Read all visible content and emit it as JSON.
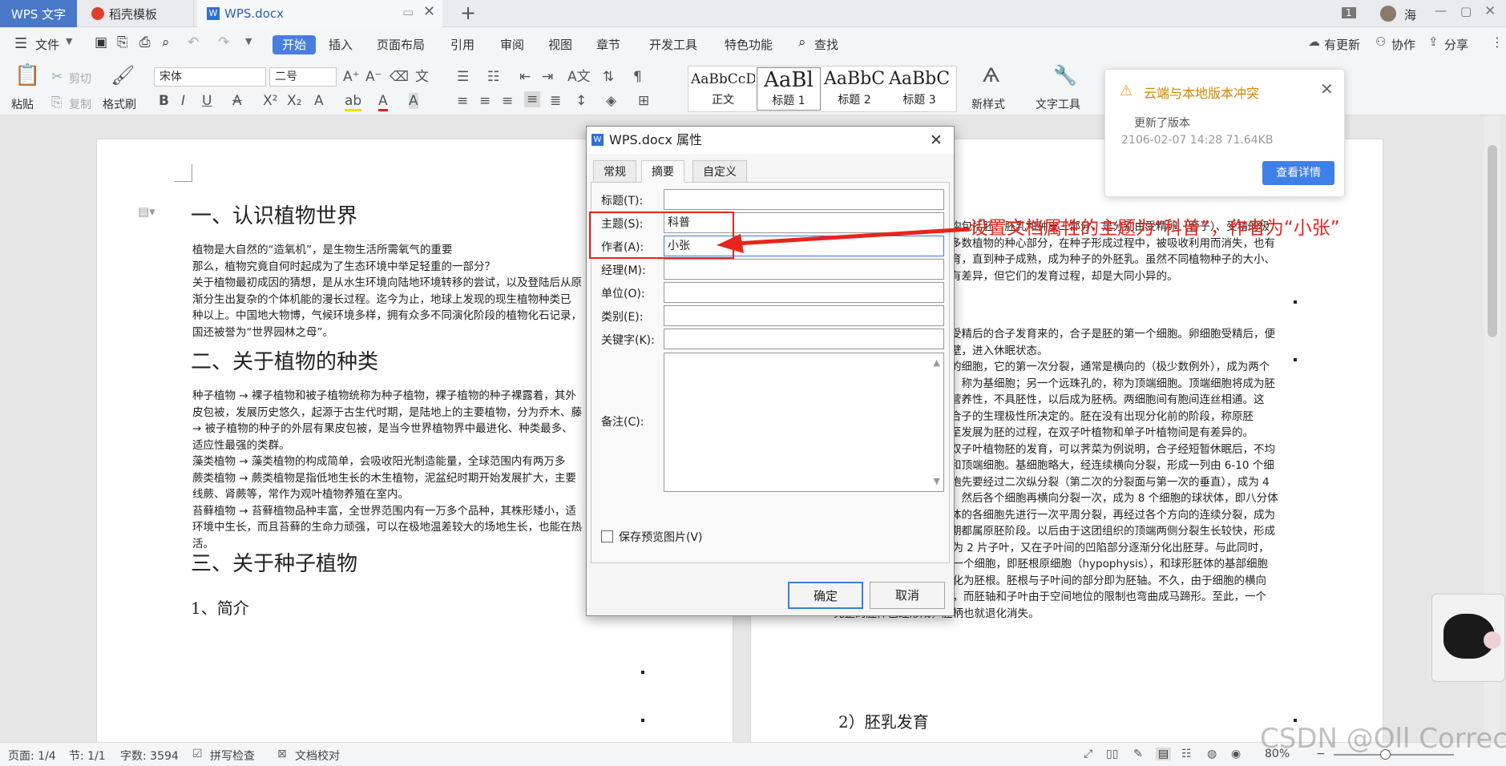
{
  "tabs": {
    "app": "WPS 文字",
    "template": "稻壳模板",
    "doc": "WPS.docx"
  },
  "tabbar_right": {
    "badge": "1",
    "user": "海"
  },
  "menu": {
    "file": "文件",
    "start": "开始",
    "insert": "插入",
    "layout": "页面布局",
    "ref": "引用",
    "review": "审阅",
    "view": "视图",
    "chapter": "章节",
    "dev": "开发工具",
    "special": "特色功能",
    "find": "查找",
    "update": "有更新",
    "collab": "协作",
    "share": "分享"
  },
  "ribbon": {
    "paste": "粘贴",
    "cut": "剪切",
    "copy": "复制",
    "format_painter": "格式刷",
    "font": "宋体",
    "size": "二号",
    "new_style": "新样式",
    "text_tool": "文字工具",
    "styles": [
      {
        "preview": "AaBbCcDd",
        "name": "正文"
      },
      {
        "preview": "AaBl",
        "name": "标题 1"
      },
      {
        "preview": "AaBbC",
        "name": "标题 2"
      },
      {
        "preview": "AaBbC",
        "name": "标题 3"
      }
    ]
  },
  "doc_left": {
    "h1": "一、认识植物世界",
    "p1": [
      "植物是大自然的“造氧机”，是生物生活所需氧气的重要",
      "那么，植物究竟自何时起成为了生态环境中举足轻重的一部分？",
      "关于植物最初成因的猜想，是从水生环境向陆地环境转移的尝试，以及登陆后从原",
      "渐分生出复杂的个体机能的漫长过程。迄今为止，地球上发现的现生植物种类已",
      "种以上。中国地大物博，气候环境多样，拥有众多不同演化阶段的植物化石记录，",
      "国还被誉为“世界园林之母”。"
    ],
    "h2": "二、关于植物的种类",
    "p2": [
      "种子植物 → 裸子植物和被子植物统称为种子植物，裸子植物的种子裸露着，其外",
      "皮包被，发展历史悠久，起源于古生代时期，是陆地上的主要植物，分为乔木、藤",
      "→ 被子植物的种子的外层有果皮包被，是当今世界植物界中最进化、种类最多、",
      "适应性最强的类群。",
      "藻类植物 → 藻类植物的构成简单，会吸收阳光制造能量，全球范围内有两万多",
      "蕨类植物 → 蕨类植物是指低地生长的木生植物，泥盆纪时期开始发展扩大，主要",
      "线蕨、肾蕨等，常作为观叶植物养殖在室内。",
      "苔藓植物 → 苔藓植物品种丰富，全世界范围内有一万多个品种，其株形矮小，适",
      "环境中生长，而且苔藓的生命力顽强，可以在极地温差较大的场地生长，也能在热",
      "活。"
    ],
    "h3": "三、关于种子植物",
    "h4": "1、简介"
  },
  "doc_right": {
    "p1": [
      "构包括胚、胚乳和种皮三部分，是分别由受精卵（合子）、受精的极",
      "多数植物的种心部分，在种子形成过程中，被吸收利用而消失，也有",
      "育，直到种子成熟，成为种子的外胚乳。虽然不同植物种子的大小、",
      "有差异，但它们的发育过程，却是大同小异的。"
    ],
    "p2": [
      "受精后的合子发育来的，合子是胚的第一个细胞。卵细胞受精后，便",
      "壁，进入休眠状态。",
      "的细胞，它的第一次分裂，通常是横向的（极少数例外），成为两个",
      "，称为基细胞；另一个远珠孔的，称为顶端细胞。顶端细胞将成为胚",
      "营养性，不具胚性，以后成为胚柄。两细胞间有胞间连丝相通。这",
      "合子的生理极性所决定的。胚在没有出现分化前的阶段，称原胚",
      "至发展为胚的过程，在双子叶植物和单子叶植物间是有差异的。",
      "双子叶植物胚的发育，可以荠菜为例说明，合子经短暂休眠后，不均",
      "和顶端细胞。基细胞略大，经连续横向分裂，形成一列由 6-10 个细",
      "胞先要经过二次纵分裂（第二次的分裂面与第一次的垂直），成为 4",
      "；然后各个细胞再横向分裂一次，成为 8 个细胞的球状体，即八分体",
      "体的各细胞先进行一次平周分裂，再经过各个方向的连续分裂，成为",
      "期都属原胚阶段。以后由于这团组织的顶端两侧分裂生长较快，形成",
      "二个突起，迅速发育，成为 2 片子叶，又在子叶间的凹陷部分逐渐分化出胚芽。与此同时，",
      "球形胚体下方的胚柄顶端一个细胞，即胚根原细胞（hypophysis），和球形胚体的基部细胞",
      "也不断分裂生长，一起分化为胚根。胚根与子叶间的部分即为胚轴。不久，由于细胞的横向",
      "分裂，使子叶和胚轴延长，而胚轴和子叶由于空间地位的限制也弯曲成马蹄形。至此，一个",
      "完整的胚体已经形成，胚柄也就退化消失。"
    ],
    "h": "2）胚乳发育"
  },
  "dialog": {
    "title": "WPS.docx 属性",
    "tabs": [
      "常规",
      "摘要",
      "自定义"
    ],
    "fields": [
      {
        "label": "标题(T):",
        "value": ""
      },
      {
        "label": "主题(S):",
        "value": "科普"
      },
      {
        "label": "作者(A):",
        "value": "小张"
      },
      {
        "label": "经理(M):",
        "value": ""
      },
      {
        "label": "单位(O):",
        "value": ""
      },
      {
        "label": "类别(E):",
        "value": ""
      },
      {
        "label": "关键字(K):",
        "value": ""
      }
    ],
    "notes_label": "备注(C):",
    "save_preview": "保存预览图片(V)",
    "ok": "确定",
    "cancel": "取消"
  },
  "notice": {
    "title": "云端与本地版本冲突",
    "line1": "更新了版本",
    "line2": "2106-02-07 14:28 71.64KB",
    "button": "查看详情"
  },
  "annotation": "设置文档属性的主题为“科普”，作者为“小张”",
  "status": {
    "page": "页面: 1/4",
    "section": "节: 1/1",
    "words": "字数: 3594",
    "spell": "拼写检查",
    "proof": "文档校对",
    "zoom": "80%"
  },
  "watermark": "CSDN @Oll Correct",
  "colors": {
    "accent": "#4a7de0",
    "annotation": "#e8241c",
    "warning": "#f0a020"
  }
}
